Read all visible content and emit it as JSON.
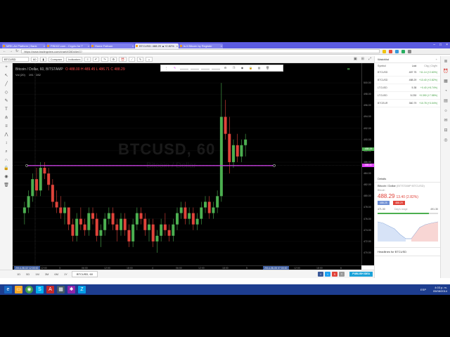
{
  "browser": {
    "tabs": [
      {
        "label": "MRK-Air Platform | Bank"
      },
      {
        "label": "FINVIZ.com - Crypto for T"
      },
      {
        "label": "Home Fathom"
      },
      {
        "label": "BTCUSD: 488.29 ▲+2.82%"
      },
      {
        "label": "Is it Bitcoin by Register"
      }
    ],
    "url": "https://www.tradingview.com/chart/t/280d4e47/"
  },
  "toolbar": {
    "symbol": "BTCUSD",
    "interval": "60",
    "buttons": [
      "Compare",
      "Indicators"
    ]
  },
  "legend": {
    "title": "Bitcoin / Dollar, 60, BITSTAMP",
    "values": "O 488.00 H 489.45 L 486.71 C 488.29",
    "vol_row": "Vol (20)",
    "vol_values": "191 · 282"
  },
  "watermark": {
    "main": "BTCUSD, 60",
    "sub": "Bitcoin / Dollar"
  },
  "price_axis": [
    "500.00",
    "498.00",
    "496.00",
    "494.00",
    "492.00",
    "490.00",
    "488.00",
    "486.00",
    "484.00",
    "482.00",
    "480.00",
    "478.00",
    "476.00",
    "474.00",
    "472.00",
    "470.00"
  ],
  "price_tags": {
    "last": "488.29",
    "line": "485.40"
  },
  "time_axis": [
    {
      "label": "2014-08-02 12:00:00",
      "hi": true
    },
    {
      "label": "12:00"
    },
    {
      "label": "3"
    },
    {
      "label": "06:00"
    },
    {
      "label": "12:00"
    },
    {
      "label": "18:00"
    },
    {
      "label": "4"
    },
    {
      "label": "06:00"
    },
    {
      "label": "12:00"
    },
    {
      "label": "18:00"
    },
    {
      "label": "5"
    },
    {
      "label": "2014-08-05 07:00:00",
      "hi": true
    },
    {
      "label": "12:00"
    },
    {
      "label": "18:00"
    },
    {
      "label": "6"
    }
  ],
  "bottom": {
    "ranges": [
      "1D",
      "5D",
      "1M",
      "3M",
      "6M",
      "1Y"
    ],
    "chart_tab": "BTCUSD, 60",
    "publish": "PUBLISH IDEA"
  },
  "watchlist": {
    "title": "Watchlist",
    "columns": [
      "Symbol",
      "Last",
      "Chg | Chg%"
    ],
    "rows": [
      {
        "sym": "BTCUSD",
        "last": "487.75",
        "chg": "+11.14 (+2.60%)",
        "dir": "up"
      },
      {
        "sym": "BTCUSD",
        "last": "488.29",
        "chg": "+13.40 (+2.82%)",
        "dir": "up"
      },
      {
        "sym": "LTCUSD",
        "last": "5.38",
        "chg": "+0.40 (+8.74%)",
        "dir": "up"
      },
      {
        "sym": "LTCUSD",
        "last": "5.230",
        "chg": "+0.390 (+7.58%)",
        "dir": "up"
      },
      {
        "sym": "BTCEUR",
        "last": "360.79",
        "chg": "+10.78 (+3.04%)",
        "dir": "up"
      }
    ]
  },
  "details": {
    "title": "Details",
    "name": "Bitcoin / Dollar",
    "exchange": "(BITSTAMP:BTCUSD)",
    "sub": "Bitcoin",
    "price": "488.29",
    "change": "13.40 (2.82%)",
    "bid": "488.25",
    "ask": "488.29",
    "low": "471.30",
    "high": "491.30",
    "range_label": "Day's range",
    "headlines": "Headlines for BTCUSD"
  },
  "taskbar": {
    "time": "4:03 p. m.",
    "date": "05/08/2014",
    "lang": "ESP"
  },
  "chart_data": {
    "type": "candlestick",
    "title": "Bitcoin / Dollar, 60, BITSTAMP",
    "ylim": [
      470,
      501
    ],
    "horizontal_line": 485.4,
    "colors": {
      "up": "#4caf50",
      "down": "#e0433a",
      "line": "#e040fb"
    },
    "candles": [
      [
        477,
        479,
        475,
        478
      ],
      [
        478,
        481,
        477,
        480
      ],
      [
        480,
        484,
        479,
        483
      ],
      [
        483,
        485,
        480,
        481
      ],
      [
        481,
        486,
        480,
        485
      ],
      [
        485,
        486,
        483,
        484
      ],
      [
        484,
        485,
        481,
        482
      ],
      [
        482,
        483,
        478,
        479
      ],
      [
        479,
        481,
        477,
        478
      ],
      [
        478,
        480,
        476,
        477
      ],
      [
        477,
        479,
        475,
        478
      ],
      [
        478,
        478,
        474,
        475
      ],
      [
        475,
        476,
        472,
        473
      ],
      [
        473,
        477,
        472,
        476
      ],
      [
        476,
        478,
        474,
        475
      ],
      [
        475,
        476,
        473,
        474
      ],
      [
        474,
        478,
        473,
        477
      ],
      [
        477,
        478,
        475,
        476
      ],
      [
        476,
        477,
        472,
        473
      ],
      [
        473,
        475,
        471,
        474
      ],
      [
        474,
        477,
        473,
        476
      ],
      [
        476,
        478,
        475,
        477
      ],
      [
        477,
        478,
        474,
        475
      ],
      [
        475,
        476,
        472,
        474
      ],
      [
        474,
        477,
        473,
        476
      ],
      [
        476,
        477,
        473,
        474
      ],
      [
        474,
        475,
        471,
        472
      ],
      [
        472,
        476,
        471,
        475
      ],
      [
        475,
        478,
        474,
        477
      ],
      [
        477,
        478,
        475,
        476
      ],
      [
        476,
        477,
        473,
        474
      ],
      [
        474,
        476,
        472,
        475
      ],
      [
        475,
        476,
        471,
        472
      ],
      [
        472,
        474,
        470,
        473
      ],
      [
        473,
        476,
        472,
        475
      ],
      [
        475,
        477,
        473,
        474
      ],
      [
        474,
        475,
        472,
        473
      ],
      [
        473,
        476,
        472,
        475
      ],
      [
        475,
        478,
        474,
        477
      ],
      [
        477,
        479,
        476,
        478
      ],
      [
        478,
        479,
        475,
        476
      ],
      [
        476,
        478,
        475,
        477
      ],
      [
        477,
        478,
        474,
        475
      ],
      [
        475,
        477,
        474,
        476
      ],
      [
        476,
        479,
        475,
        478
      ],
      [
        478,
        480,
        477,
        479
      ],
      [
        479,
        480,
        476,
        477
      ],
      [
        477,
        479,
        476,
        478
      ],
      [
        478,
        481,
        477,
        480
      ],
      [
        480,
        500,
        479,
        494
      ],
      [
        494,
        497,
        490,
        491
      ],
      [
        491,
        494,
        484,
        486
      ],
      [
        486,
        490,
        485,
        489
      ],
      [
        489,
        491,
        486,
        487
      ],
      [
        487,
        490,
        486,
        489
      ],
      [
        489,
        491,
        487,
        490
      ]
    ]
  }
}
